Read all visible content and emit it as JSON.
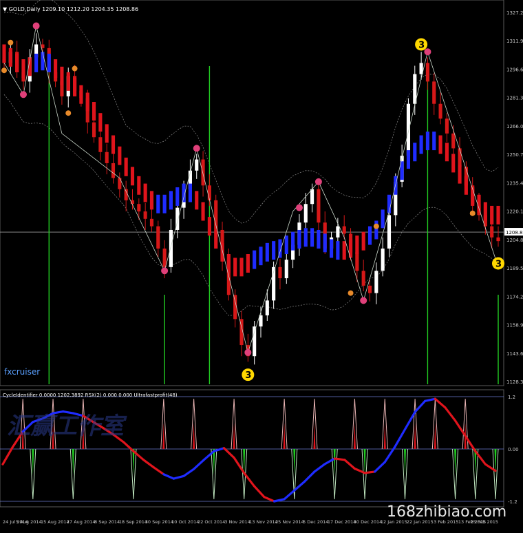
{
  "window": {
    "symbol_header": "▼ GOLD,Daily  1209.10 1212.20 1204.35 1208.86",
    "indicator_header": "CycleIdentifier 0.0000 1202.3892  RSX(2) 0.000 0.000  Ultrafastprofit(48)",
    "brand_text": "fxcruiser",
    "watermark_cn": "汇赢工作室",
    "watermark_site": "168zhibiao.com"
  },
  "colors": {
    "background": "#000000",
    "bull_candle": "#ffffff",
    "bear_candle": "#d61818",
    "trend_up": "#1f2cff",
    "trend_down": "#e0141c",
    "signal_line": "#22cc22",
    "band": "#7a7a7a",
    "zigzag": "#c9d6c9",
    "marker_pink": "#e0407a",
    "marker_orange": "#e88a2a",
    "marker_yellow": "#ffd800",
    "axis_text": "#c8c8c8"
  },
  "markers": {
    "swing_label": "3"
  },
  "chart_data": [
    {
      "type": "candlestick",
      "title": "GOLD,Daily",
      "ylim": [
        1128.35,
        1327.25
      ],
      "y_ticks": [
        1327.25,
        1311.95,
        1296.65,
        1281.35,
        1266.05,
        1250.75,
        1235.45,
        1220.15,
        1204.85,
        1189.55,
        1174.25,
        1158.95,
        1143.65,
        1128.35
      ],
      "current_price": 1208.86,
      "current_price_label": "1208.86",
      "x_tick_labels": [
        "24 Jul 2014",
        "5 Aug 2014",
        "15 Aug 2014",
        "27 Aug 2014",
        "8 Sep 2014",
        "18 Sep 2014",
        "30 Sep 2014",
        "10 Oct 2014",
        "22 Oct 2014",
        "3 Nov 2014",
        "13 Nov 2014",
        "25 Nov 2014",
        "5 Dec 2014",
        "17 Dec 2014",
        "30 Dec 2014",
        "12 Jan 2015",
        "22 Jan 2015",
        "3 Feb 2015",
        "13 Feb 2015",
        "25 Feb 2015"
      ],
      "close_path": [
        1300,
        1306,
        1295,
        1290,
        1303,
        1310,
        1308,
        1295,
        1290,
        1282,
        1293,
        1285,
        1281,
        1268,
        1260,
        1252,
        1246,
        1238,
        1232,
        1226,
        1224,
        1220,
        1216,
        1212,
        1200,
        1190,
        1210,
        1222,
        1232,
        1242,
        1248,
        1234,
        1226,
        1210,
        1194,
        1175,
        1162,
        1148,
        1142,
        1158,
        1164,
        1172,
        1190,
        1184,
        1194,
        1202,
        1214,
        1224,
        1232,
        1214,
        1200,
        1206,
        1212,
        1208,
        1198,
        1188,
        1180,
        1176,
        1188,
        1200,
        1218,
        1236,
        1250,
        1278,
        1294,
        1300,
        1290,
        1278,
        1270,
        1262,
        1254,
        1244,
        1234,
        1224,
        1218,
        1212,
        1206,
        1204
      ],
      "trend_line": [
        1305,
        1303,
        1300,
        1297,
        1298,
        1300,
        1301,
        1300,
        1297,
        1293,
        1290,
        1287,
        1283,
        1279,
        1274,
        1268,
        1262,
        1256,
        1250,
        1244,
        1239,
        1234,
        1230,
        1226,
        1224,
        1224,
        1226,
        1228,
        1230,
        1230,
        1226,
        1220,
        1212,
        1205,
        1198,
        1192,
        1190,
        1190,
        1192,
        1194,
        1196,
        1198,
        1199,
        1200,
        1202,
        1204,
        1205,
        1206,
        1206,
        1205,
        1203,
        1200,
        1199,
        1199,
        1200,
        1202,
        1204,
        1207,
        1210,
        1216,
        1224,
        1234,
        1242,
        1248,
        1252,
        1256,
        1258,
        1258,
        1256,
        1252,
        1246,
        1240,
        1234,
        1228,
        1224,
        1220,
        1218,
        1218
      ],
      "trend_up_segments": [
        [
          5,
          7
        ],
        [
          24,
          29
        ],
        [
          39,
          52
        ],
        [
          57,
          67
        ]
      ],
      "zigzag": [
        [
          0,
          1300
        ],
        [
          3,
          1283
        ],
        [
          5,
          1320
        ],
        [
          9,
          1262
        ],
        [
          18,
          1238
        ],
        [
          25,
          1188
        ],
        [
          30,
          1254
        ],
        [
          38,
          1144
        ],
        [
          45,
          1220
        ],
        [
          49,
          1236
        ],
        [
          53,
          1206
        ],
        [
          56,
          1172
        ],
        [
          60,
          1220
        ],
        [
          66,
          1306
        ],
        [
          77,
          1190
        ]
      ],
      "pink_markers": [
        [
          3,
          1283
        ],
        [
          5,
          1320
        ],
        [
          25,
          1188
        ],
        [
          30,
          1254
        ],
        [
          38,
          1144
        ],
        [
          46,
          1222
        ],
        [
          49,
          1236
        ],
        [
          56,
          1172
        ],
        [
          66,
          1306
        ]
      ],
      "orange_markers": [
        [
          0,
          1296
        ],
        [
          1,
          1311
        ],
        [
          11,
          1297
        ],
        [
          10,
          1273
        ],
        [
          54,
          1176
        ],
        [
          58,
          1212
        ],
        [
          73,
          1219
        ]
      ],
      "yellow_markers": [
        [
          38,
          1132
        ],
        [
          65,
          1310
        ],
        [
          77,
          1192
        ]
      ],
      "signal_lines_full": [
        7,
        32,
        66
      ],
      "signal_lines_low": [
        25,
        77
      ]
    },
    {
      "type": "line",
      "title": "CycleIdentifier 0.0000 1202.3892  RSX(2) 0.000 0.000  Ultrafastprofit(48)",
      "ylim": [
        -1.2,
        1.2
      ],
      "y_ticks": [
        1.2,
        0.0,
        -1.2
      ],
      "y_tick_labels": [
        "1.2",
        "0.00",
        "-1.2"
      ],
      "smooth_line": [
        -0.35,
        0.05,
        0.4,
        0.62,
        0.7,
        0.82,
        0.86,
        0.82,
        0.76,
        0.62,
        0.48,
        0.33,
        0.16,
        -0.05,
        -0.25,
        -0.42,
        -0.58,
        -0.68,
        -0.62,
        -0.46,
        -0.25,
        -0.05,
        0.02,
        -0.2,
        -0.55,
        -0.85,
        -1.1,
        -1.2,
        -1.15,
        -0.95,
        -0.75,
        -0.52,
        -0.35,
        -0.22,
        -0.25,
        -0.45,
        -0.55,
        -0.52,
        -0.3,
        0.05,
        0.45,
        0.85,
        1.1,
        1.15,
        0.95,
        0.65,
        0.3,
        -0.05,
        -0.35,
        -0.5
      ],
      "rising_segments": [
        [
          2,
          8
        ],
        [
          16,
          22
        ],
        [
          27,
          33
        ],
        [
          37,
          43
        ]
      ],
      "spike_up": [
        2,
        5,
        8,
        16,
        19,
        23,
        28,
        31,
        35,
        38,
        41,
        43,
        46
      ],
      "spike_down": [
        3,
        7,
        13,
        21,
        24,
        29,
        33,
        36,
        40,
        45,
        47,
        49
      ]
    }
  ]
}
